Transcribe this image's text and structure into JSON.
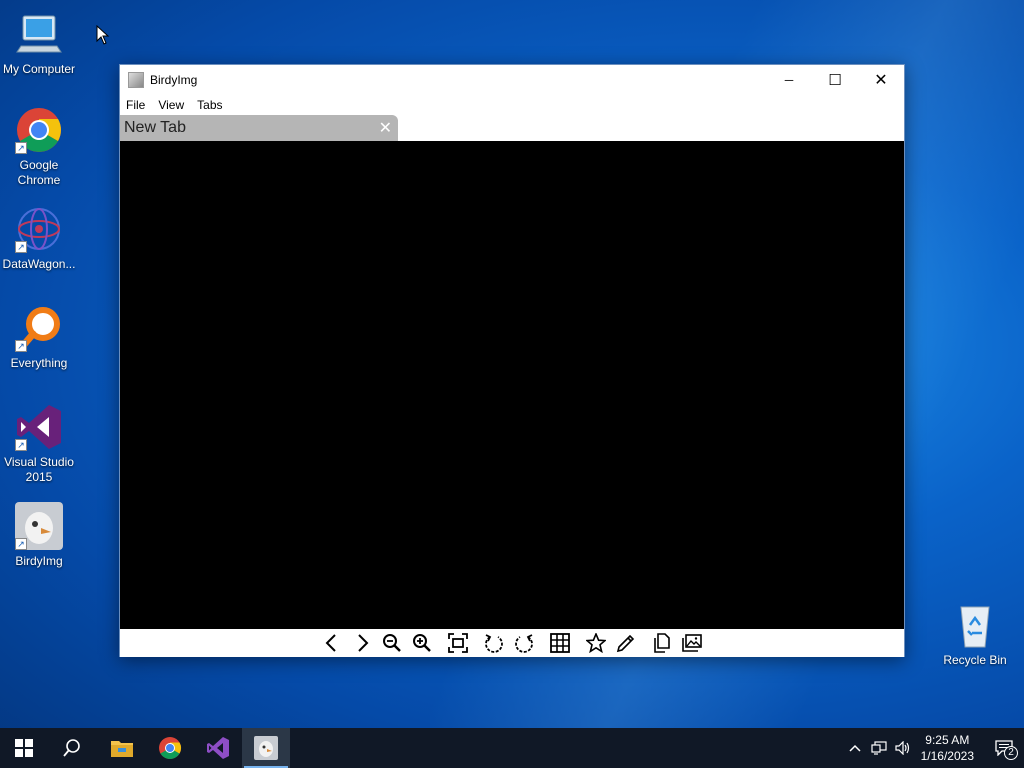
{
  "desktop": {
    "icons": [
      {
        "label": "My Computer",
        "icon": "computer-icon"
      },
      {
        "label": "Google Chrome",
        "icon": "chrome-icon"
      },
      {
        "label": "DataWagon...",
        "icon": "datawagon-icon"
      },
      {
        "label": "Everything",
        "icon": "everything-icon"
      },
      {
        "label": "Visual Studio 2015",
        "icon": "visual-studio-icon"
      },
      {
        "label": "BirdyImg",
        "icon": "birdyimg-icon"
      },
      {
        "label": "Recycle Bin",
        "icon": "recycle-bin-icon"
      }
    ]
  },
  "window": {
    "title": "BirdyImg",
    "controls": {
      "minimize": "─",
      "maximize": "☐",
      "close": "✕"
    },
    "menu": [
      "File",
      "View",
      "Tabs"
    ],
    "tabs": [
      {
        "label": "New Tab",
        "close": "✕"
      }
    ],
    "toolbar": [
      "previous-icon",
      "next-icon",
      "zoom-out-icon",
      "zoom-in-icon",
      "fit-to-window-icon",
      "rotate-left-icon",
      "rotate-right-icon",
      "grid-icon",
      "favorite-star-icon",
      "edit-pencil-icon",
      "copy-icon",
      "gallery-icon"
    ]
  },
  "taskbar": {
    "items": [
      "start-icon",
      "search-icon",
      "file-explorer-icon",
      "chrome-icon",
      "visual-studio-icon",
      "birdyimg-icon"
    ],
    "active": "birdyimg-icon",
    "clock": {
      "time": "9:25 AM",
      "date": "1/16/2023"
    },
    "notifications": "2"
  },
  "colors": {
    "accent": "#0a63c9",
    "taskbar": "#101826",
    "tab": "#b5b5b5",
    "viewer": "#000000"
  }
}
